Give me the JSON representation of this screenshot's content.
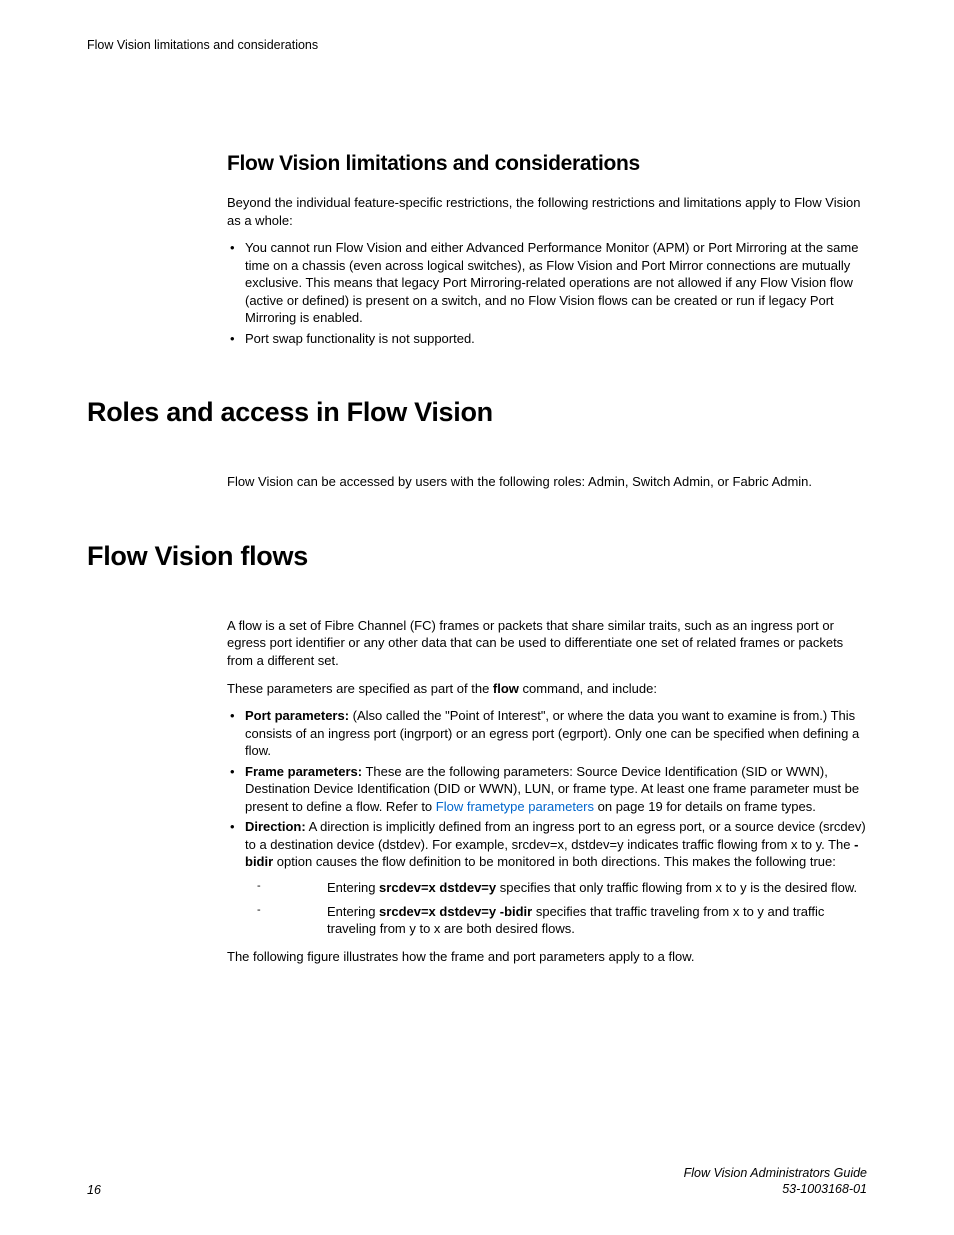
{
  "runningHeader": "Flow Vision limitations and considerations",
  "section1": {
    "title": "Flow Vision limitations and considerations",
    "intro": "Beyond the individual feature-specific restrictions, the following restrictions and limitations apply to Flow Vision as a whole:",
    "bullet1": "You cannot run Flow Vision and either Advanced Performance Monitor (APM) or Port Mirroring at the same time on a chassis (even across logical switches), as Flow Vision and Port Mirror connections are mutually exclusive. This means that legacy Port Mirroring-related operations are not allowed if any Flow Vision flow (active or defined) is present on a switch, and no Flow Vision flows can be created or run if legacy Port Mirroring is enabled.",
    "bullet2": "Port swap functionality is not supported."
  },
  "section2": {
    "title": "Roles and access in Flow Vision",
    "body": "Flow Vision can be accessed by users with the following roles: Admin, Switch Admin, or Fabric Admin."
  },
  "section3": {
    "title": "Flow Vision flows",
    "p1": "A flow is a set of Fibre Channel (FC) frames or packets that share similar traits, such as an ingress port or egress port identifier or any other data that can be used to differentiate one set of related frames or packets from a different set.",
    "p2_pre": "These parameters are specified as part of the ",
    "p2_bold": "flow",
    "p2_post": " command, and include:",
    "b1_label": "Port parameters:",
    "b1_text": " (Also called the \"Point of Interest\", or where the data you want to examine is from.) This consists of an ingress port (ingrport) or an egress port (egrport). Only one can be specified when defining a flow.",
    "b2_label": "Frame parameters:",
    "b2_text_pre": " These are the following parameters: Source Device Identification (SID or WWN), Destination Device Identification (DID or WWN), LUN, or frame type. At least one frame parameter must be present to define a flow. Refer to ",
    "b2_link": "Flow frametype parameters",
    "b2_text_post": " on page 19 for details on frame types.",
    "b3_label": "Direction:",
    "b3_text_pre": " A direction is implicitly defined from an ingress port to an egress port, or a source device (srcdev) to a destination device (dstdev). For example, srcdev=x, dstdev=y indicates traffic flowing from x to y. The ",
    "b3_bold": "-bidir",
    "b3_text_post": " option causes the flow definition to be monitored in both directions. This makes the following true:",
    "d1_pre": "Entering ",
    "d1_bold": "srcdev=x dstdev=y",
    "d1_post": " specifies that only traffic flowing from x to y is the desired flow.",
    "d2_pre": "Entering ",
    "d2_bold": "srcdev=x dstdev=y -bidir",
    "d2_post": " specifies that traffic traveling from x to y and traffic traveling from y to x are both desired flows.",
    "closing": "The following figure illustrates how the frame and port parameters apply to a flow."
  },
  "footer": {
    "pageNum": "16",
    "docTitle": "Flow Vision Administrators Guide",
    "docId": "53-1003168-01"
  }
}
